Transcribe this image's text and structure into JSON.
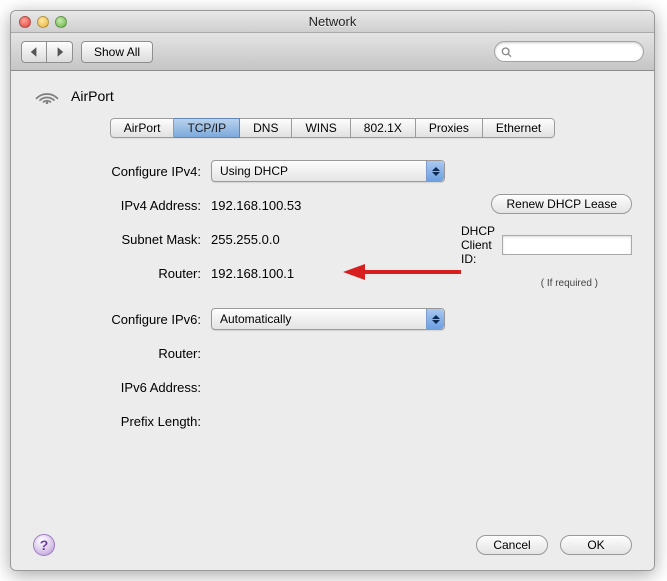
{
  "window": {
    "title": "Network"
  },
  "toolbar": {
    "show_all": "Show All",
    "search_placeholder": ""
  },
  "header": {
    "service": "AirPort"
  },
  "tabs": [
    {
      "label": "AirPort"
    },
    {
      "label": "TCP/IP",
      "active": true
    },
    {
      "label": "DNS"
    },
    {
      "label": "WINS"
    },
    {
      "label": "802.1X"
    },
    {
      "label": "Proxies"
    },
    {
      "label": "Ethernet"
    }
  ],
  "form": {
    "configure_ipv4_label": "Configure IPv4:",
    "configure_ipv4_value": "Using DHCP",
    "ipv4_address_label": "IPv4 Address:",
    "ipv4_address_value": "192.168.100.53",
    "subnet_mask_label": "Subnet Mask:",
    "subnet_mask_value": "255.255.0.0",
    "router_label": "Router:",
    "router_value": "192.168.100.1",
    "configure_ipv6_label": "Configure IPv6:",
    "configure_ipv6_value": "Automatically",
    "router6_label": "Router:",
    "router6_value": "",
    "ipv6_address_label": "IPv6 Address:",
    "ipv6_address_value": "",
    "prefix_length_label": "Prefix Length:",
    "prefix_length_value": "",
    "renew_lease": "Renew DHCP Lease",
    "dhcp_client_id_label": "DHCP Client ID:",
    "dhcp_client_id_value": "",
    "if_required": "( If required )"
  },
  "footer": {
    "cancel": "Cancel",
    "ok": "OK"
  }
}
